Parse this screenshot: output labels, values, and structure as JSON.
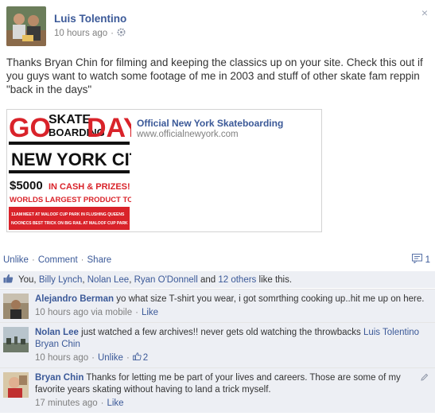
{
  "post": {
    "author": "Luis Tolentino",
    "timestamp": "10 hours ago",
    "audience_icon": "gear-icon",
    "close_glyph": "×",
    "text": "Thanks Bryan Chin for filming and keeping the classics up on your site. Check this out if you guys want to watch some footage of me in 2003 and stuff of other skate fam reppin \"back in the days\""
  },
  "share": {
    "title": "Official New York Skateboarding",
    "url": "www.officialnewyork.com",
    "poster": {
      "go": "GO",
      "skate": "SKATE",
      "boarding": "BOARDING",
      "day": "DAY",
      "city": "NEW YORK CITY",
      "prize_amount": "$5000",
      "prize_text": "IN CASH & PRIZES!",
      "toss": "WORLDS LARGEST PRODUCT TOSS!",
      "line1_tag": "11AM",
      "line1": "MEET AT MALOOF CUP PARK IN FLUSHING QUEENS",
      "line2_tag": "NOON",
      "line2": "CCS BEST TRICK ON BIG RAIL AT MALOOF CUP PARK"
    }
  },
  "actions": {
    "unlike": "Unlike",
    "comment": "Comment",
    "share": "Share",
    "sep": "·",
    "comment_count": "1"
  },
  "likes": {
    "you": "You,",
    "names": [
      "Billy Lynch",
      "Nolan Lee",
      "Ryan O'Donnell"
    ],
    "and": "and",
    "others": "12 others",
    "suffix": "like this."
  },
  "comments": [
    {
      "name": "Alejandro Berman",
      "text": "yo what size T-shirt you wear, i got somrthing cooking up..hit me up on here.",
      "time": "10 hours ago via mobile",
      "like": "Like"
    },
    {
      "name": "Nolan Lee",
      "text": "just watched a few archives!! never gets old watching the throwbacks",
      "mentions": "Luis Tolentino Bryan Chin",
      "time": "10 hours ago",
      "unlike": "Unlike",
      "like_count": "2"
    },
    {
      "name": "Bryan Chin",
      "text": "Thanks for letting me be part of your lives and careers. Those are some of my favorite years skating without having to land a trick myself.",
      "time": "17 minutes ago",
      "like": "Like"
    }
  ],
  "colors": {
    "link": "#3b5998",
    "ufi_bg": "#edeff4",
    "poster_red": "#d9232a"
  }
}
